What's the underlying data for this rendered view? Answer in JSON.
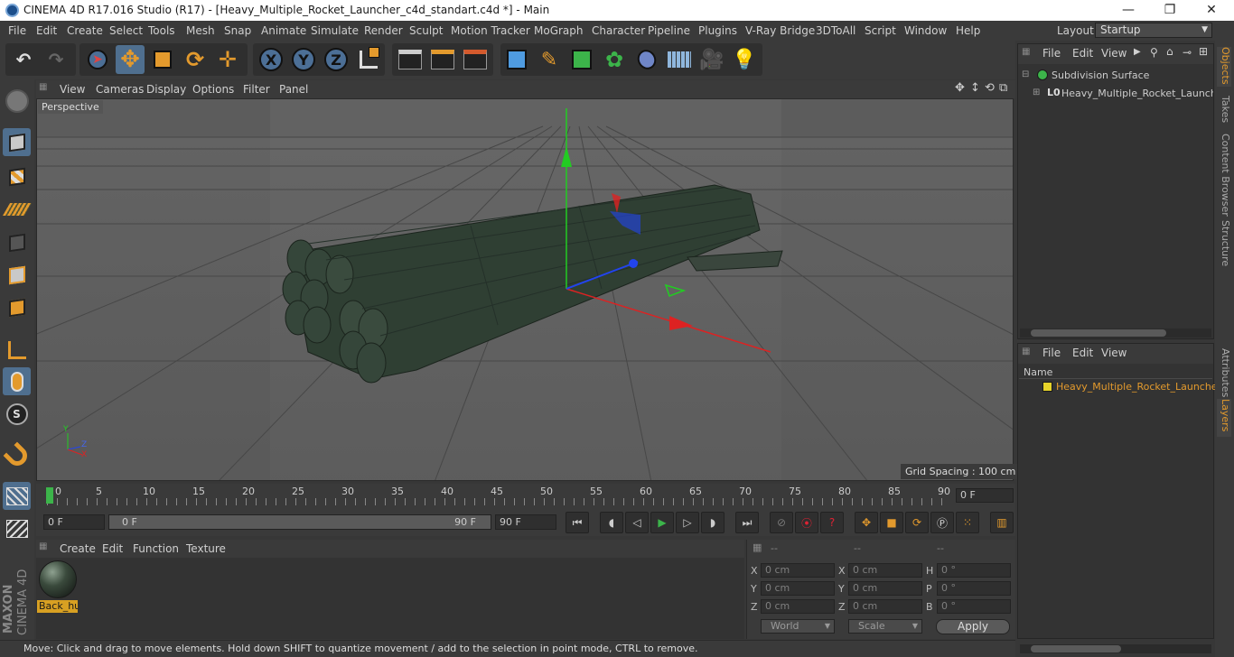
{
  "window": {
    "title": "CINEMA 4D R17.016 Studio (R17) - [Heavy_Multiple_Rocket_Launcher_c4d_standart.c4d *] - Main",
    "minimize": "—",
    "maximize": "❐",
    "close": "✕"
  },
  "menu": [
    "File",
    "Edit",
    "Create",
    "Select",
    "Tools",
    "Mesh",
    "Snap",
    "Animate",
    "Simulate",
    "Render",
    "Sculpt",
    "Motion Tracker",
    "MoGraph",
    "Character",
    "Pipeline",
    "Plugins",
    "V-Ray Bridge",
    "3DToAll",
    "Script",
    "Window",
    "Help"
  ],
  "layout": {
    "label": "Layout:",
    "value": "Startup"
  },
  "toolbar": {
    "x_label": "X",
    "y_label": "Y",
    "z_label": "Z"
  },
  "viewport": {
    "menu": [
      "View",
      "Cameras",
      "Display",
      "Options",
      "Filter",
      "Panel"
    ],
    "camera_label": "Perspective",
    "grid_spacing": "Grid Spacing : 100 cm",
    "axis_x": "X",
    "axis_y": "Y",
    "axis_z": "Z"
  },
  "timeline": {
    "ticks": [
      "0",
      "5",
      "10",
      "15",
      "20",
      "25",
      "30",
      "35",
      "40",
      "45",
      "50",
      "55",
      "60",
      "65",
      "70",
      "75",
      "80",
      "85",
      "90"
    ],
    "current_frame": "0 F",
    "end_field": "0 F"
  },
  "transport": {
    "start_field": "0 F",
    "range_start": "0 F",
    "range_end": "90 F",
    "end_field": "90 F"
  },
  "material_manager": {
    "menu": [
      "Create",
      "Edit",
      "Function",
      "Texture"
    ],
    "material_name": "Back_hu"
  },
  "coordinates": {
    "headers": [
      "--",
      "--",
      "--"
    ],
    "rows": [
      {
        "a": "X",
        "a_val": "0 cm",
        "b": "X",
        "b_val": "0 cm",
        "c": "H",
        "c_val": "0 °"
      },
      {
        "a": "Y",
        "a_val": "0 cm",
        "b": "Y",
        "b_val": "0 cm",
        "c": "P",
        "c_val": "0 °"
      },
      {
        "a": "Z",
        "a_val": "0 cm",
        "b": "Z",
        "b_val": "0 cm",
        "c": "B",
        "c_val": "0 °"
      }
    ],
    "mode": "World",
    "transform": "Scale",
    "apply": "Apply"
  },
  "status": "Move: Click and drag to move elements. Hold down SHIFT to quantize movement / add to the selection in point mode, CTRL to remove.",
  "objects_panel": {
    "menu": [
      "File",
      "Edit",
      "View"
    ],
    "items": [
      "Subdivision Surface",
      "Heavy_Multiple_Rocket_Launche"
    ]
  },
  "layers_panel": {
    "menu": [
      "File",
      "Edit",
      "View"
    ],
    "column": "Name",
    "items": [
      "Heavy_Multiple_Rocket_Launcher"
    ]
  },
  "side_tabs": [
    "Objects",
    "Takes",
    "Content Browser",
    "Structure",
    "Attributes",
    "Layers"
  ],
  "logo": {
    "top": "MAXON",
    "bottom": "CINEMA 4D"
  }
}
